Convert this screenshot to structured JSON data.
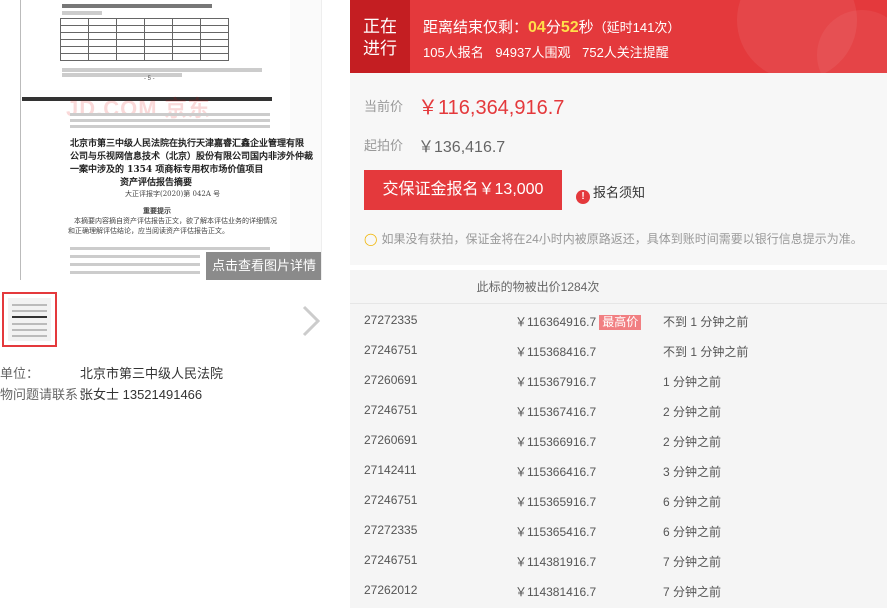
{
  "document": {
    "watermark": "JD.COM 京东",
    "lines": [
      "北京市第三中级人民法院在执行天津嘉睿汇鑫企业管理有限",
      "公司与乐视网信息技术（北京）股份有限公司国内非涉外仲裁",
      "一案中涉及的 1354 项商标专用权市场价值项目"
    ],
    "subtitle": "资产评估报告摘要",
    "report_no": "大正评报字(2020)第 042A 号",
    "notice_title": "重要提示",
    "notice_lines": [
      "本摘要内容摘自资产评估报告正文，欲了解本评估业务的详细情况",
      "和正确理解评估结论，应当阅读资产评估报告正文。"
    ],
    "page_no": "- 5 -"
  },
  "detail_button": "点击查看图片详情",
  "info": [
    {
      "label": "单位：",
      "value": "北京市第三中级人民法院"
    },
    {
      "label": "物问题请联系：",
      "value": "张女士 13521491466"
    }
  ],
  "status": {
    "tag_line1": "正在",
    "tag_line2": "进行",
    "countdown_label": "距离结束仅剩：",
    "minutes": "04",
    "min_unit": "分",
    "seconds": "52",
    "sec_unit": "秒",
    "extension": "（延时141次）",
    "signups": "105人报名",
    "watchers": "94937人围观",
    "followers": "752人关注提醒"
  },
  "price": {
    "current_label": "当前价",
    "current_value": "￥116,364,916.7",
    "start_label": "起拍价",
    "start_value": "￥136,416.7",
    "bid_button": "交保证金报名￥13,000",
    "notice_label": "报名须知",
    "tip": "如果没有获拍，保证金将在24小时内被原路返还，具体到账时间需要以银行信息提示为准。"
  },
  "records": {
    "title": "此标的物被出价1284次",
    "highest_tag": "最高价",
    "rows": [
      {
        "uid": "27272335",
        "amount": "￥116364916.7",
        "time": "不到 1 分钟之前",
        "highest": true
      },
      {
        "uid": "27246751",
        "amount": "￥115368416.7",
        "time": "不到 1 分钟之前",
        "highest": false
      },
      {
        "uid": "27260691",
        "amount": "￥115367916.7",
        "time": "1 分钟之前",
        "highest": false
      },
      {
        "uid": "27246751",
        "amount": "￥115367416.7",
        "time": "2 分钟之前",
        "highest": false
      },
      {
        "uid": "27260691",
        "amount": "￥115366916.7",
        "time": "2 分钟之前",
        "highest": false
      },
      {
        "uid": "27142411",
        "amount": "￥115366416.7",
        "time": "3 分钟之前",
        "highest": false
      },
      {
        "uid": "27246751",
        "amount": "￥115365916.7",
        "time": "6 分钟之前",
        "highest": false
      },
      {
        "uid": "27272335",
        "amount": "￥115365416.7",
        "time": "6 分钟之前",
        "highest": false
      },
      {
        "uid": "27246751",
        "amount": "￥114381916.7",
        "time": "7 分钟之前",
        "highest": false
      },
      {
        "uid": "27262012",
        "amount": "￥114381416.7",
        "time": "7 分钟之前",
        "highest": false
      }
    ]
  },
  "colors": {
    "accent": "#e4393c",
    "status_dark": "#c41e22",
    "highlight": "#ffdf4a"
  }
}
